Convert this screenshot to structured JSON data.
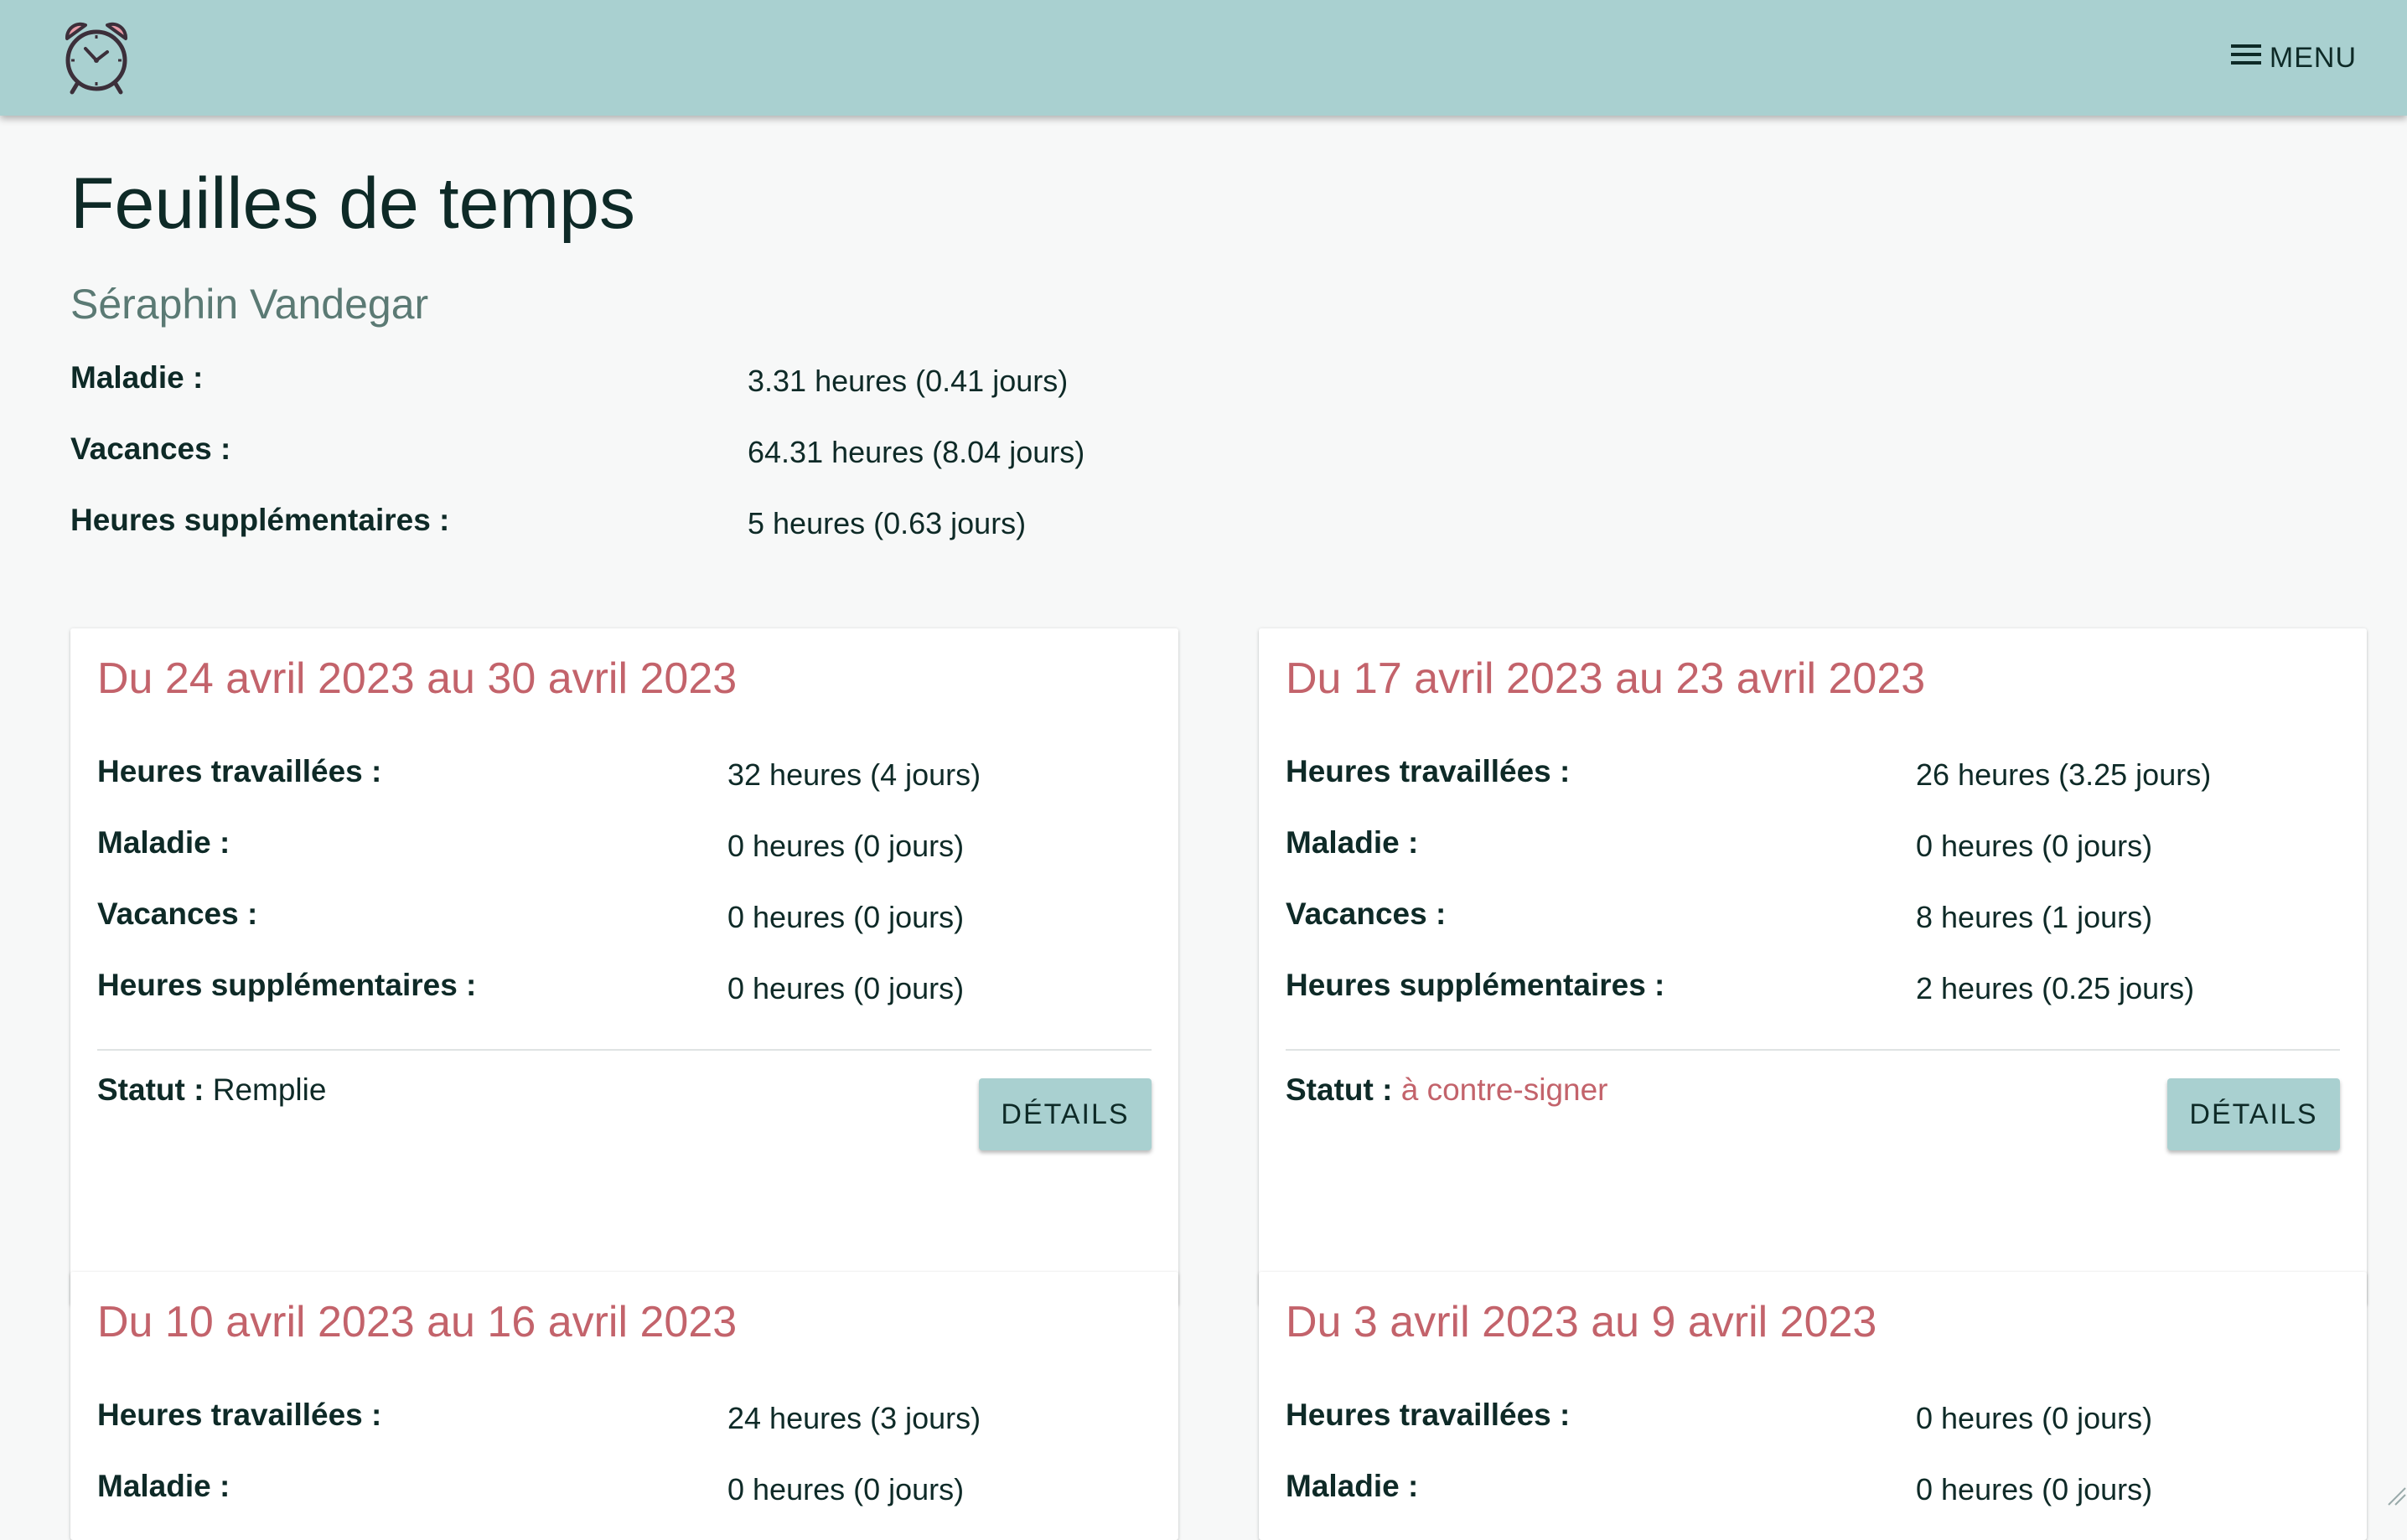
{
  "header": {
    "logo_icon": "alarm-clock-icon",
    "menu_icon": "hamburger-icon",
    "menu_label": "MENU"
  },
  "page": {
    "title": "Feuilles de temps",
    "user_name": "Séraphin Vandegar"
  },
  "summary": [
    {
      "label": "Maladie :",
      "value": "3.31 heures (0.41 jours)"
    },
    {
      "label": "Vacances :",
      "value": "64.31 heures (8.04 jours)"
    },
    {
      "label": "Heures supplémentaires :",
      "value": "5 heures (0.63 jours)"
    }
  ],
  "cards": [
    {
      "title": "Du 24 avril 2023 au 30 avril 2023",
      "rows": [
        {
          "label": "Heures travaillées :",
          "value": "32 heures (4 jours)"
        },
        {
          "label": "Maladie :",
          "value": "0 heures (0 jours)"
        },
        {
          "label": "Vacances :",
          "value": "0 heures (0 jours)"
        },
        {
          "label": "Heures supplémentaires :",
          "value": "0 heures (0 jours)"
        }
      ],
      "status_label": "Statut :",
      "status_value": "Remplie",
      "details_label": "DÉTAILS"
    },
    {
      "title": "Du 17 avril 2023 au 23 avril 2023",
      "rows": [
        {
          "label": "Heures travaillées :",
          "value": "26 heures (3.25 jours)"
        },
        {
          "label": "Maladie :",
          "value": "0 heures (0 jours)"
        },
        {
          "label": "Vacances :",
          "value": "8 heures (1 jours)"
        },
        {
          "label": "Heures supplémentaires :",
          "value": "2 heures (0.25 jours)"
        }
      ],
      "status_label": "Statut :",
      "status_value": "à contre-signer",
      "details_label": "DÉTAILS"
    },
    {
      "title": "Du 10 avril 2023 au 16 avril 2023",
      "rows": [
        {
          "label": "Heures travaillées :",
          "value": "24 heures (3 jours)"
        },
        {
          "label": "Maladie :",
          "value": "0 heures (0 jours)"
        }
      ]
    },
    {
      "title": "Du 3 avril 2023 au 9 avril 2023",
      "rows": [
        {
          "label": "Heures travaillées :",
          "value": "0 heures (0 jours)"
        },
        {
          "label": "Maladie :",
          "value": "0 heures (0 jours)"
        }
      ]
    }
  ],
  "colors": {
    "header_bg": "#a9d0d0",
    "accent": "#c3636b",
    "text": "#0e2a27",
    "subtitle": "#5b7a74",
    "page_bg": "#f7f8f8"
  }
}
